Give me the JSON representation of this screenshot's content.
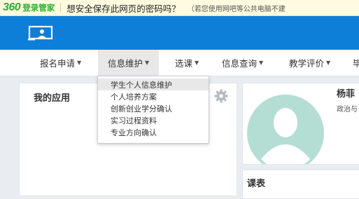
{
  "password_bar": {
    "brand_number": "360",
    "brand_text": "登录管家",
    "question": "想安全保存此网页的密码吗？",
    "note": "（若您使用网吧等公共电脑不建"
  },
  "nav": {
    "items": [
      {
        "label": "报名申请"
      },
      {
        "label": "信息维护"
      },
      {
        "label": "选课"
      },
      {
        "label": "信息查询"
      },
      {
        "label": "教学评价"
      },
      {
        "label": "毕"
      }
    ],
    "active_index": 1
  },
  "dropdown": {
    "items": [
      {
        "label": "学生个人信息维护"
      },
      {
        "label": "个人培养方案"
      },
      {
        "label": "创新创业学分确认"
      },
      {
        "label": "实习过程资料"
      },
      {
        "label": "专业方向确认"
      }
    ],
    "hover_index": 0
  },
  "my_apps": {
    "title": "我的应用"
  },
  "profile": {
    "name": "杨菲",
    "dept": "政治与"
  },
  "schedule": {
    "title": "课表"
  },
  "icons": {
    "logo": "screen-user-icon",
    "settings": "gear-icon",
    "avatar": "avatar-placeholder-icon",
    "caret": "caret-down-icon"
  },
  "colors": {
    "header_blue": "#0d7fd9",
    "brand_green": "#2eae31",
    "page_bg": "#e9edf2",
    "avatar_teal": "#b4ded4"
  }
}
